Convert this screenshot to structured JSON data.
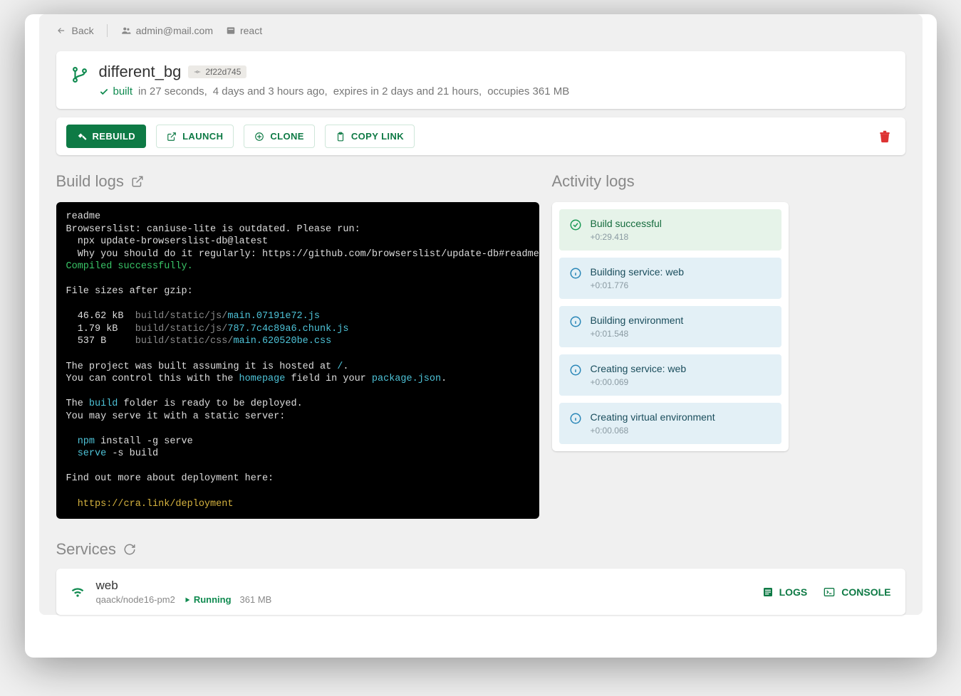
{
  "nav": {
    "back": "Back",
    "user": "admin@mail.com",
    "project_type": "react"
  },
  "project": {
    "name": "different_bg",
    "commit": "2f22d745",
    "status": "built",
    "build_time": "in 27 seconds,",
    "age": "4 days and 3 hours ago,",
    "expires": "expires in 2 days and 21 hours,",
    "size": "occupies 361 MB"
  },
  "actions": {
    "rebuild": "REBUILD",
    "launch": "LAUNCH",
    "clone": "CLONE",
    "copy": "COPY LINK"
  },
  "sections": {
    "build_logs": "Build logs",
    "activity_logs": "Activity logs",
    "services": "Services"
  },
  "build_log": {
    "l0": "readme",
    "l1": "Browserslist: caniuse-lite is outdated. Please run:",
    "l2": "  npx update-browserslist-db@latest",
    "l3": "  Why you should do it regularly: https://github.com/browserslist/update-db#readme",
    "l4": "Compiled successfully.",
    "l5": "File sizes after gzip:",
    "f1_size": "  46.62 kB",
    "f1_path": "  build/static/js/",
    "f1_file": "main.07191e72.js",
    "f2_size": "  1.79 kB ",
    "f2_path": "  build/static/js/",
    "f2_file": "787.7c4c89a6.chunk.js",
    "f3_size": "  537 B   ",
    "f3_path": "  build/static/css/",
    "f3_file": "main.620520be.css",
    "l6a": "The project was built assuming it is hosted at ",
    "l6b": "/",
    "l6c": ".",
    "l7a": "You can control this with the ",
    "l7b": "homepage",
    "l7c": " field in your ",
    "l7d": "package.json",
    "l7e": ".",
    "l8a": "The ",
    "l8b": "build",
    "l8c": " folder is ready to be deployed.",
    "l9": "You may serve it with a static server:",
    "l10a": "  npm",
    "l10b": " install -g serve",
    "l11a": "  serve",
    "l11b": " -s build",
    "l12": "Find out more about deployment here:",
    "l13": "  https://cra.link/deployment"
  },
  "activity": [
    {
      "title": "Build successful",
      "time": "+0:29.418",
      "type": "success"
    },
    {
      "title": "Building service: web",
      "time": "+0:01.776",
      "type": "info"
    },
    {
      "title": "Building environment",
      "time": "+0:01.548",
      "type": "info"
    },
    {
      "title": "Creating service: web",
      "time": "+0:00.069",
      "type": "info"
    },
    {
      "title": "Creating virtual environment",
      "time": "+0:00.068",
      "type": "info"
    }
  ],
  "service": {
    "name": "web",
    "image": "qaack/node16-pm2",
    "state": "Running",
    "size": "361 MB",
    "logs": "LOGS",
    "console": "CONSOLE"
  }
}
